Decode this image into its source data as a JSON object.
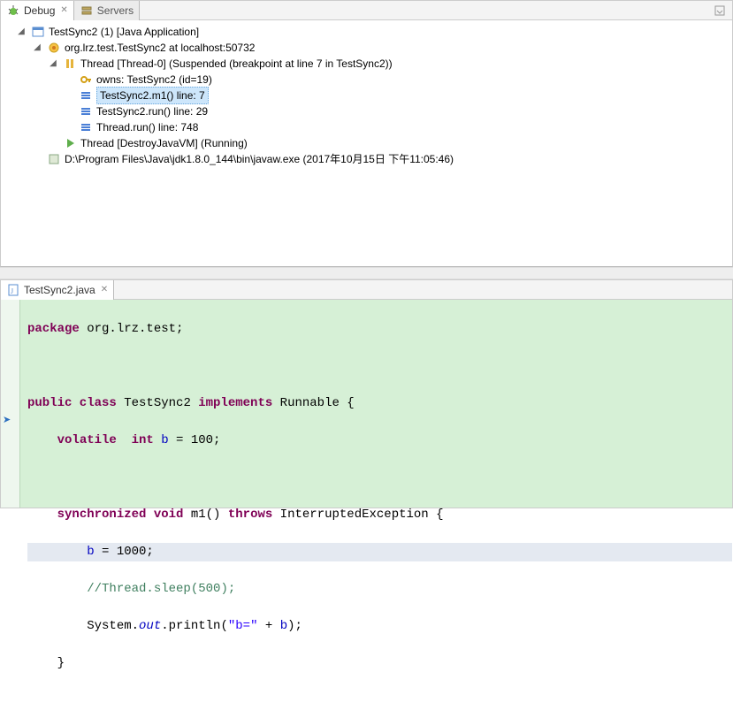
{
  "debug": {
    "tab_active": "Debug",
    "tab_inactive": "Servers",
    "tree": {
      "app": "TestSync2 (1) [Java Application]",
      "target": "org.lrz.test.TestSync2 at localhost:50732",
      "thread0": "Thread [Thread-0] (Suspended (breakpoint at line 7 in TestSync2))",
      "owns": "owns: TestSync2  (id=19)",
      "frame_sel": "TestSync2.m1() line: 7",
      "frame_run": "TestSync2.run() line: 29",
      "frame_thread_run": "Thread.run() line: 748",
      "thread_vm": "Thread [DestroyJavaVM] (Running)",
      "process": "D:\\Program Files\\Java\\jdk1.8.0_144\\bin\\javaw.exe (2017年10月15日 下午11:05:46)"
    }
  },
  "editor": {
    "tab": "TestSync2.java",
    "code": {
      "l1a": "package",
      "l1b": " org.lrz.test;",
      "l3a": "public class",
      "l3b": " TestSync2 ",
      "l3c": "implements",
      "l3d": " Runnable {",
      "l4a": "    ",
      "l4b": "volatile  int",
      "l4c": " ",
      "l4d": "b",
      "l4e": " = 100;",
      "l6a": "    ",
      "l6b": "synchronized void",
      "l6c": " m1() ",
      "l6d": "throws",
      "l6e": " InterruptedException {",
      "l7a": "        ",
      "l7b": "b",
      "l7c": " = 1000;",
      "l8a": "        ",
      "l8b": "//Thread.sleep(500);",
      "l9a": "        System.",
      "l9b": "out",
      "l9c": ".println(",
      "l9d": "\"b=\"",
      "l9e": " + ",
      "l9f": "b",
      "l9g": ");",
      "l10": "    }"
    }
  }
}
